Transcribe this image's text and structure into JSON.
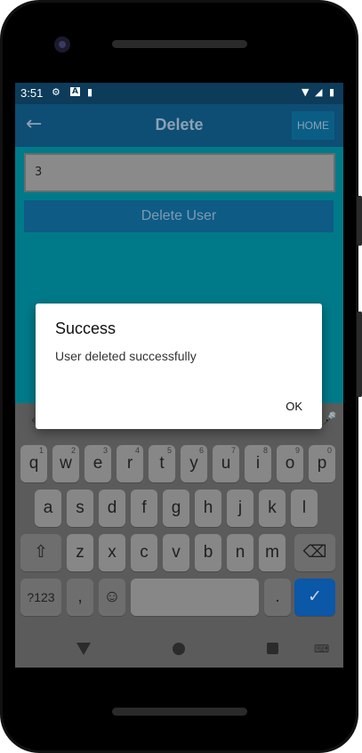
{
  "status_bar": {
    "time": "3:51",
    "icons": [
      "gear-icon",
      "a-icon",
      "sd-card-icon",
      "wifi-icon",
      "signal-icon",
      "battery-icon"
    ]
  },
  "app_bar": {
    "title": "Delete",
    "home_label": "HOME"
  },
  "form": {
    "id_value": "3",
    "delete_label": "Delete User"
  },
  "dialog": {
    "title": "Success",
    "message": "User deleted successfully",
    "ok_label": "OK"
  },
  "keyboard": {
    "row1": [
      {
        "k": "q",
        "h": "1"
      },
      {
        "k": "w",
        "h": "2"
      },
      {
        "k": "e",
        "h": "3"
      },
      {
        "k": "r",
        "h": "4"
      },
      {
        "k": "t",
        "h": "5"
      },
      {
        "k": "y",
        "h": "6"
      },
      {
        "k": "u",
        "h": "7"
      },
      {
        "k": "i",
        "h": "8"
      },
      {
        "k": "o",
        "h": "9"
      },
      {
        "k": "p",
        "h": "0"
      }
    ],
    "row2": [
      "a",
      "s",
      "d",
      "f",
      "g",
      "h",
      "j",
      "k",
      "l"
    ],
    "row3": [
      "z",
      "x",
      "c",
      "v",
      "b",
      "n",
      "m"
    ],
    "symbols_label": "?123",
    "comma_label": ",",
    "period_label": "."
  },
  "colors": {
    "screen_bg": "#007a89",
    "appbar": "#0e4d74",
    "keyboard_bg": "#5b5b5b",
    "enter_key": "#0b57a8"
  }
}
